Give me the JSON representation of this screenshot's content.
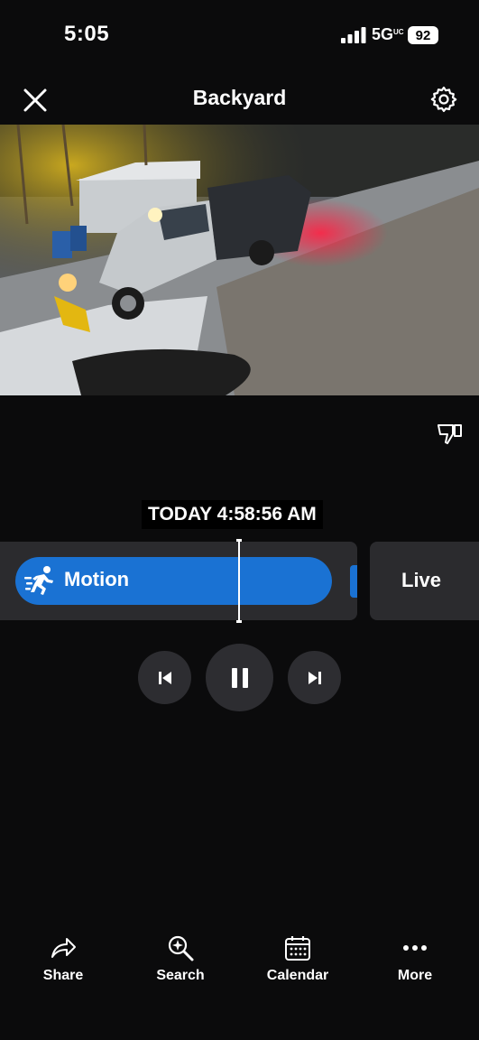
{
  "status_bar": {
    "time": "5:05",
    "network": "5G",
    "network_sub": "UC",
    "battery": "92"
  },
  "header": {
    "title": "Backyard",
    "close_icon": "close-icon",
    "settings_icon": "gear-icon"
  },
  "video": {
    "expand_icon": "expand-arrows-icon",
    "fullscreen_icon": "fullscreen-icon"
  },
  "feedback_icon": "thumbs-down-icon",
  "timeline": {
    "timestamp": "TODAY 4:58:56 AM",
    "event_label": "Motion",
    "event_color": "#1a72d3",
    "live_label": "Live"
  },
  "playback": {
    "state": "playing",
    "prev_icon": "skip-previous-icon",
    "pause_icon": "pause-icon",
    "next_icon": "skip-next-icon"
  },
  "nav": {
    "share": "Share",
    "search": "Search",
    "calendar": "Calendar",
    "more": "More"
  }
}
